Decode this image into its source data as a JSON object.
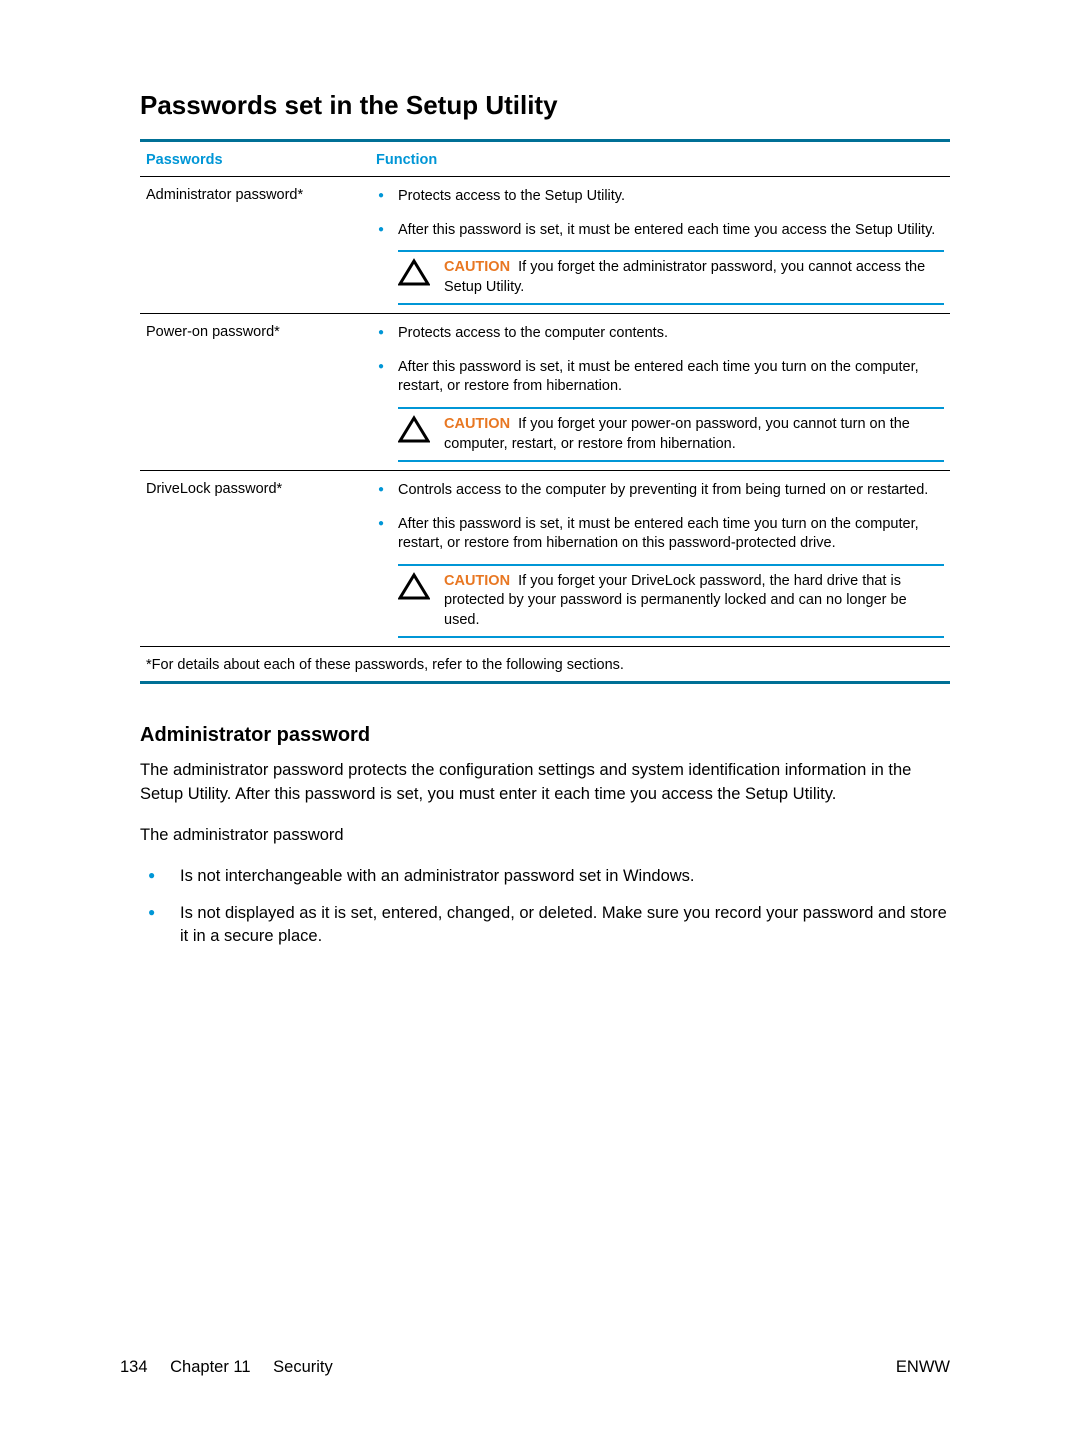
{
  "section_title": "Passwords set in the Setup Utility",
  "table": {
    "headers": {
      "col1": "Passwords",
      "col2": "Function"
    },
    "rows": [
      {
        "name": "Administrator password*",
        "bullets": [
          "Protects access to the Setup Utility.",
          "After this password is set, it must be entered each time you access the Setup Utility."
        ],
        "caution_label": "CAUTION",
        "caution": "If you forget the administrator password, you cannot access the Setup Utility."
      },
      {
        "name": "Power-on password*",
        "bullets": [
          "Protects access to the computer contents.",
          "After this password is set, it must be entered each time you turn on the computer, restart, or restore from hibernation."
        ],
        "caution_label": "CAUTION",
        "caution": "If you forget your power-on password, you cannot turn on the computer, restart, or restore from hibernation."
      },
      {
        "name": "DriveLock password*",
        "bullets": [
          "Controls access to the computer by preventing it from being turned on or restarted.",
          "After this password is set, it must be entered each time you turn on the computer, restart, or restore from hibernation on this password-protected drive."
        ],
        "caution_label": "CAUTION",
        "caution": "If you forget your DriveLock password, the hard drive that is protected by your password is permanently locked and can no longer be used."
      }
    ],
    "footnote": "*For details about each of these passwords, refer to the following sections."
  },
  "subsection_title": "Administrator password",
  "paragraphs": [
    "The administrator password protects the configuration settings and system identification information in the Setup Utility. After this password is set, you must enter it each time you access the Setup Utility.",
    "The administrator password"
  ],
  "details": [
    "Is not interchangeable with an administrator password set in Windows.",
    "Is not displayed as it is set, entered, changed, or deleted. Make sure you record your password and store it in a secure place."
  ],
  "footer": {
    "page_number": "134",
    "chapter": "Chapter 11",
    "chapter_title": "Security",
    "right": "ENWW"
  }
}
